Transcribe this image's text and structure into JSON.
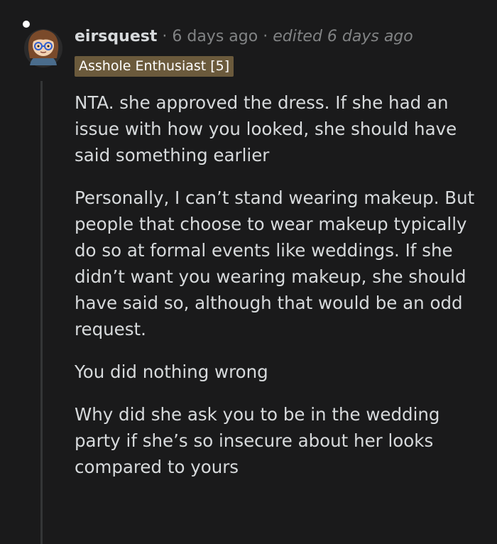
{
  "comment": {
    "username": "eirsquest",
    "separator": "·",
    "time_ago": "6 days ago",
    "edited": "edited 6 days ago",
    "flair": "Asshole Enthusiast [5]",
    "paragraphs": [
      "NTA. she approved the dress. If she had an issue with how you looked, she should have said something earlier",
      "Personally, I can’t stand wearing makeup. But people that choose to wear makeup typically do so at formal events like weddings. If she didn’t want you wearing makeup, she should have said so, although that would be an odd request.",
      "You did nothing wrong",
      "Why did she ask you to be in the wedding party if she’s so insecure about her looks compared to yours"
    ]
  },
  "colors": {
    "background": "#1a1a1b",
    "text": "#d7dadc",
    "meta": "#818384",
    "flair_bg": "#6b5a3c",
    "thread_line": "#343536"
  },
  "icons": {
    "avatar": "user-avatar-cartoon"
  }
}
